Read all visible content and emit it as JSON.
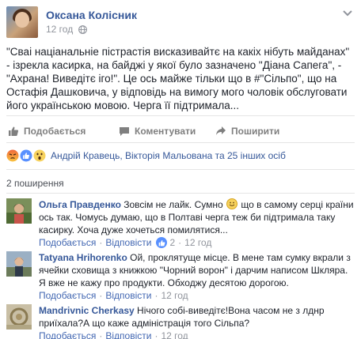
{
  "post": {
    "author": "Оксана Колісник",
    "time": "12 год",
    "text": "\"Сваі націанальніе пістрастія висказивайтє на какіх нібуть майданах\" - ізрекла касирка, на байджі у якої було зазначено \"Діана Сапега\", - \"Ахрана! Виведітє іго!\". Це ось майже тільки що в #\"Сільпо\", що на Остафія Дашковича, у відповідь на вимогу мого чоловік обслуговати його українською мовою. Черга її підтримала...",
    "actions": {
      "like": "Подобається",
      "comment": "Коментувати",
      "share": "Поширити"
    },
    "reactions_text": "Андрій Кравець, Вікторія Мальована та 25 інших осіб",
    "shares_text": "2 поширення"
  },
  "comments": [
    {
      "author": "Ольга Правденко",
      "text_before": " Зовсім не лайк. Сумно ",
      "text_after": " що в самому серці країни ось так. Чомусь думаю, що в Полтаві черга теж би підтримала таку касирку. Хоча дуже хочеться помилятися...",
      "like_label": "Подобається",
      "reply_label": "Відповісти",
      "likes": "2",
      "time": "12 год"
    },
    {
      "author": "Tatyana Hrihorenko",
      "text": " Ой, проклятуще місце. В мене там сумку вкрали з ячейки сховища з книжкою \"Чорний ворон\" і дарчим написом Шкляра. Я вже не кажу про продукти. Обходжу десятою дорогою.",
      "like_label": "Подобається",
      "reply_label": "Відповісти",
      "time": "12 год"
    },
    {
      "author": "Mandrivnic Cherkasy",
      "text": " Нічого собі-виведітє!Вона часом не з лднр приїхала?А що каже адміністрація того Сільпа?",
      "like_label": "Подобається",
      "reply_label": "Відповісти",
      "time": "12 год"
    }
  ],
  "colors": {
    "link": "#365899",
    "muted": "#90949c",
    "like_blue": "#5890ff"
  }
}
